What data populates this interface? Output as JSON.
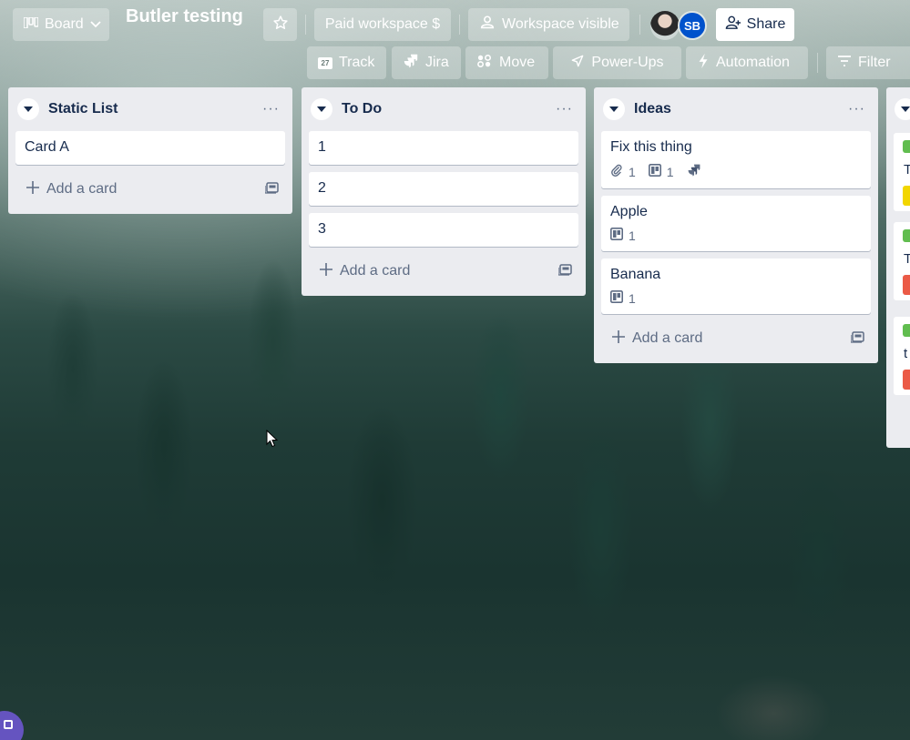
{
  "header": {
    "view_switcher_label": "Board",
    "board_title": "Butler testing",
    "workspace_label": "Paid workspace $",
    "visibility_label": "Workspace visible",
    "share_label": "Share",
    "members": [
      {
        "initials": "SB",
        "color": "#0052cc"
      }
    ]
  },
  "toolbar": {
    "track_label": "Track",
    "jira_label": "Jira",
    "move_label": "Move",
    "powerups_label": "Power-Ups",
    "automation_label": "Automation",
    "filter_label": "Filter",
    "track_icon_text": "27"
  },
  "lists": [
    {
      "title": "Static List",
      "menu": "···",
      "cards": [
        {
          "title": "Card A"
        }
      ],
      "add_card_label": "Add a card"
    },
    {
      "title": "To Do",
      "menu": "···",
      "cards": [
        {
          "title": "1"
        },
        {
          "title": "2"
        },
        {
          "title": "3"
        }
      ],
      "add_card_label": "Add a card"
    },
    {
      "title": "Ideas",
      "menu": "···",
      "cards": [
        {
          "title": "Fix this thing",
          "attachments": "1",
          "checklist": "1"
        },
        {
          "title": "Apple",
          "checklist": "1"
        },
        {
          "title": "Banana",
          "checklist": "1"
        }
      ],
      "add_card_label": "Add a card"
    }
  ],
  "partial_list": {
    "card_snippets": [
      "T",
      "T",
      "t"
    ]
  },
  "colors": {
    "list_bg": "#ebecf0",
    "label_green": "#61bd4f",
    "member_blue": "#0052cc"
  }
}
